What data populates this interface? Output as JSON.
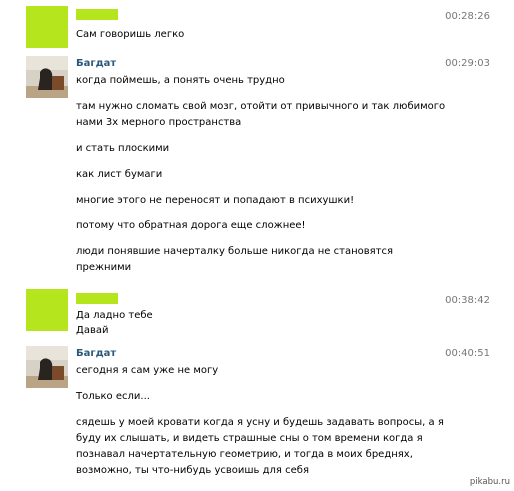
{
  "messages": [
    {
      "type": "self",
      "time": "00:28:26",
      "lines": [
        "Сам говоришь легко"
      ]
    },
    {
      "type": "contact",
      "name": "Багдат",
      "time": "00:29:03",
      "lines": [
        "когда поймешь, а понять очень трудно",
        "там нужно сломать свой мозг, отойти от привычного и так любимого",
        "нами 3х мерного пространства",
        "и стать плоскими",
        "как лист бумаги",
        "многие этого не переносят и попадают в психушки!",
        "потому что обратная дорога еще сложнее!",
        "люди понявшие начерталку больше никогда не становятся",
        "прежними"
      ]
    },
    {
      "type": "self",
      "time": "00:38:42",
      "lines": [
        "Да ладно тебе",
        "Давай"
      ]
    },
    {
      "type": "contact",
      "name": "Багдат",
      "time": "00:40:51",
      "lines": [
        "сегодня я сам уже не могу",
        "Только если...",
        "сядешь у моей кровати когда я усну и будешь задавать вопросы, а я",
        "буду их слышать, и видеть страшные сны о том времени когда я",
        "познавал начертательную геометрию, и тогда в моих бреднях,",
        "возможно, ты что-нибудь усвоишь для себя"
      ]
    }
  ],
  "watermark": "pikabu.ru",
  "colors": {
    "accent_green": "#b5e61d",
    "name_blue": "#2b587a",
    "time_gray": "#777777"
  }
}
